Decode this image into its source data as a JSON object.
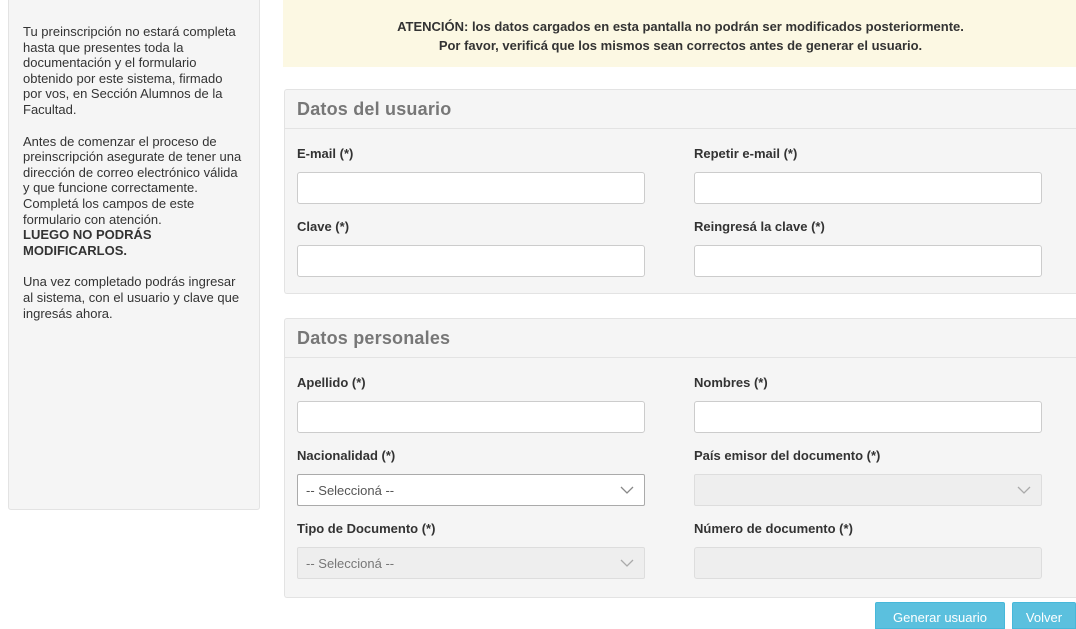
{
  "sidebar": {
    "p1": "Tu preinscripción no estará completa hasta que presentes toda la documentación y el formulario obtenido por este sistema, firmado por vos, en Sección Alumnos de la Facultad.",
    "p2": "Antes de comenzar el proceso de preinscripción asegurate de tener una dirección de correo electrónico válida y que funcione correctamente. Completá los campos de este formulario con atención.",
    "p2_strong": "LUEGO NO PODRÁS MODIFICARLOS.",
    "p3": "Una vez completado podrás ingresar al sistema, con el usuario y clave que ingresás ahora."
  },
  "alert": {
    "line1": "ATENCIÓN: los datos cargados en esta pantalla no podrán ser modificados posteriormente.",
    "line2": "Por favor, verificá que los mismos sean correctos antes de generar el usuario."
  },
  "usuario": {
    "title": "Datos del usuario",
    "email_label": "E-mail (*)",
    "email_value": "",
    "repeat_email_label": "Repetir e-mail (*)",
    "repeat_email_value": "",
    "clave_label": "Clave (*)",
    "clave_value": "",
    "reingresa_label": "Reingresá la clave (*)",
    "reingresa_value": ""
  },
  "personales": {
    "title": "Datos personales",
    "apellido_label": "Apellido (*)",
    "apellido_value": "",
    "nombres_label": "Nombres (*)",
    "nombres_value": "",
    "nacionalidad_label": "Nacionalidad (*)",
    "nacionalidad_value": "-- Seleccioná --",
    "pais_label": "País emisor del documento (*)",
    "pais_value": "",
    "tipo_doc_label": "Tipo de Documento (*)",
    "tipo_doc_value": "-- Seleccioná --",
    "numero_doc_label": "Número de documento (*)",
    "numero_doc_value": ""
  },
  "buttons": {
    "generar": "Generar usuario",
    "volver": "Volver"
  },
  "icons": {
    "select_arrow": "chevron-down-icon"
  },
  "colors": {
    "alert_bg": "#fcf8e3",
    "button_info": "#5bc0de",
    "panel_bg": "#f5f5f5"
  }
}
